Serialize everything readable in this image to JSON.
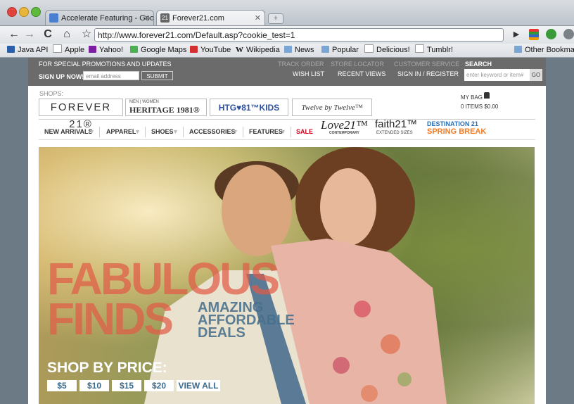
{
  "browser": {
    "tabs": [
      {
        "label": "Accelerate Featuring - Goog",
        "active": false
      },
      {
        "label": "Forever21.com",
        "active": true
      }
    ],
    "url": "http://www.forever21.com/Default.asp?cookie_test=1",
    "bookmarks": [
      "Java API",
      "Apple",
      "Yahoo!",
      "Google Maps",
      "YouTube",
      "Wikipedia",
      "News",
      "Popular",
      "Delicious!",
      "Tumblr!",
      "Other Bookmarks"
    ]
  },
  "topbar": {
    "promo": "FOR SPECIAL PROMOTIONS AND UPDATES",
    "signup": "SIGN UP NOW!",
    "email_placeholder": "email address",
    "submit": "SUBMIT",
    "links_top": [
      "TRACK ORDER",
      "STORE LOCATOR",
      "CUSTOMER SERVICE"
    ],
    "links_bottom": [
      "WISH LIST",
      "RECENT VIEWS",
      "SIGN IN / REGISTER"
    ],
    "search_label": "SEARCH",
    "search_placeholder": "enter keyword or item#",
    "go": "GO"
  },
  "shops": {
    "label": "SHOPS:",
    "forever21": "FOREVER 21®",
    "heritage_small": "MEN | WOMEN",
    "heritage": "HERITAGE 1981®",
    "htg": "HTG♥81™KIDS",
    "twelve": "Twelve by Twelve™",
    "bag_label": "MY BAG",
    "bag_items": "0 ITEMS $0.00"
  },
  "nav": {
    "items": [
      "NEW ARRIVALS",
      "APPAREL",
      "SHOES",
      "ACCESSORIES",
      "FEATURES",
      "SALE"
    ],
    "love21": "Love21™",
    "love21_sub": "CONTEMPORARY",
    "faith21": "faith21™",
    "faith21_sub": "EXTENDED SIZES",
    "destination": "DESTINATION 21",
    "spring": "SPRING BREAK"
  },
  "hero": {
    "fabulous": "FABULOUS",
    "finds": "FINDS",
    "amazing": "AMAZING",
    "affordable": "AFFORDABLE",
    "deals": "DEALS",
    "shop_by_price": "SHOP BY PRICE:",
    "prices": [
      "$5",
      "$10",
      "$15",
      "$20",
      "VIEW ALL"
    ]
  }
}
